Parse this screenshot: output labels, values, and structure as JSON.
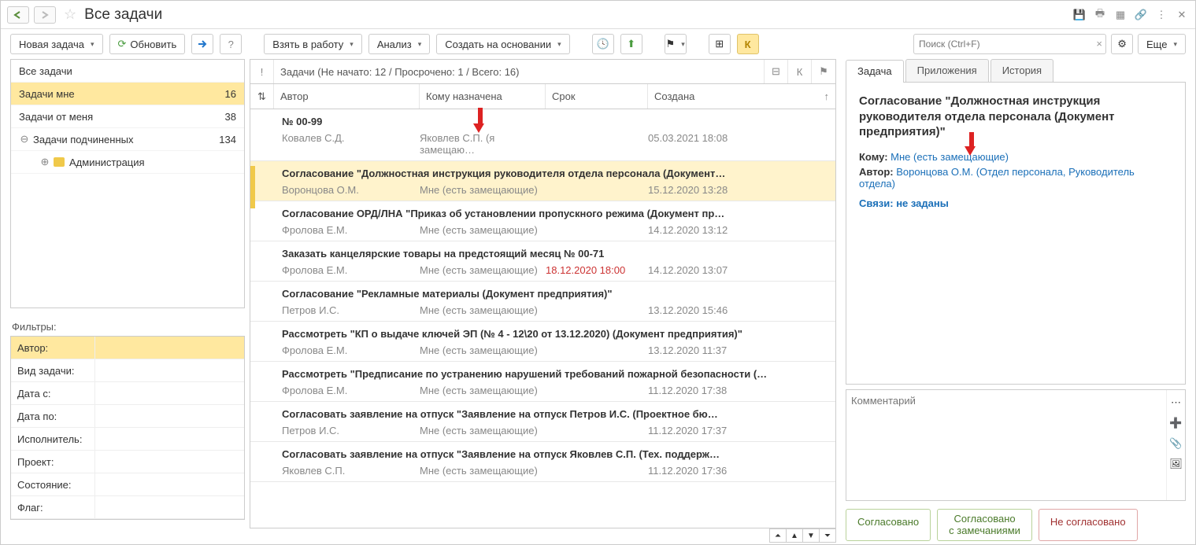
{
  "titlebar": {
    "title": "Все задачи"
  },
  "toolbar": {
    "new_task": "Новая задача",
    "refresh": "Обновить",
    "take": "Взять в работу",
    "analyze": "Анализ",
    "create_based": "Создать на основании",
    "k": "К",
    "search_placeholder": "Поиск (Ctrl+F)",
    "more": "Еще"
  },
  "tree": {
    "all": "Все задачи",
    "to_me": {
      "label": "Задачи мне",
      "count": "16"
    },
    "from_me": {
      "label": "Задачи от меня",
      "count": "38"
    },
    "subs": {
      "label": "Задачи подчиненных",
      "count": "134"
    },
    "admin": "Администрация"
  },
  "filters_label": "Фильтры:",
  "filters": [
    {
      "label": "Автор:",
      "sel": true
    },
    {
      "label": "Вид задачи:"
    },
    {
      "label": "Дата с:"
    },
    {
      "label": "Дата по:"
    },
    {
      "label": "Исполнитель:"
    },
    {
      "label": "Проект:"
    },
    {
      "label": "Состояние:"
    },
    {
      "label": "Флаг:"
    }
  ],
  "task_summary": "Задачи (Не начато: 12 / Просрочено: 1 / Всего: 16)",
  "columns": {
    "author": "Автор",
    "assignee": "Кому назначена",
    "due": "Срок",
    "created": "Создана"
  },
  "tasks": [
    {
      "title": "№  00-99",
      "author": "Ковалев С.Д.",
      "assignee": "Яковлев С.П. (я замещаю…",
      "due": "",
      "created": "05.03.2021 18:08"
    },
    {
      "title": "Согласование \"Должностная инструкция руководителя отдела персонала (Документ…",
      "author": "Воронцова О.М.",
      "assignee": "Мне (есть замещающие)",
      "due": "",
      "created": "15.12.2020 13:28",
      "sel": true
    },
    {
      "title": "Согласование ОРД/ЛНА \"Приказ об установлении пропускного режима (Документ пр…",
      "author": "Фролова Е.М.",
      "assignee": "Мне (есть замещающие)",
      "due": "",
      "created": "14.12.2020 13:12"
    },
    {
      "title": "Заказать канцелярские товары на предстоящий месяц №  00-71",
      "author": "Фролова Е.М.",
      "assignee": "Мне (есть замещающие)",
      "due": "18.12.2020 18:00",
      "due_red": true,
      "created": "14.12.2020 13:07"
    },
    {
      "title": "Согласование \"Рекламные материалы (Документ предприятия)\"",
      "author": "Петров И.С.",
      "assignee": "Мне (есть замещающие)",
      "due": "",
      "created": "13.12.2020 15:46"
    },
    {
      "title": "Рассмотреть \"КП о выдаче ключей ЭП (№ 4 - 12\\20 от 13.12.2020) (Документ предприятия)\"",
      "author": "Фролова Е.М.",
      "assignee": "Мне (есть замещающие)",
      "due": "",
      "created": "13.12.2020 11:37"
    },
    {
      "title": "Рассмотреть \"Предписание по устранению нарушений требований пожарной безопасности (…",
      "author": "Фролова Е.М.",
      "assignee": "Мне (есть замещающие)",
      "due": "",
      "created": "11.12.2020 17:38"
    },
    {
      "title": "Согласовать заявление на отпуск \"Заявление на отпуск Петров И.С. (Проектное бю…",
      "author": "Петров И.С.",
      "assignee": "Мне (есть замещающие)",
      "due": "",
      "created": "11.12.2020 17:37"
    },
    {
      "title": "Согласовать заявление на отпуск \"Заявление на отпуск Яковлев С.П. (Тех. поддерж…",
      "author": "Яковлев С.П.",
      "assignee": "Мне (есть замещающие)",
      "due": "",
      "created": "11.12.2020 17:36"
    }
  ],
  "detail": {
    "tabs": {
      "task": "Задача",
      "attachments": "Приложения",
      "history": "История"
    },
    "title": "Согласование \"Должностная инструкция руководителя отдела персонала (Документ предприятия)\"",
    "to_label": "Кому:",
    "to_value": "Мне (есть замещающие)",
    "author_label": "Автор:",
    "author_value": "Воронцова О.М. (Отдел персонала, Руководитель отдела)",
    "links_text": "Связи: не заданы",
    "comment_placeholder": "Комментарий",
    "btn_approve": "Согласовано",
    "btn_approve_notes_1": "Согласовано",
    "btn_approve_notes_2": "с замечаниями",
    "btn_reject": "Не согласовано"
  }
}
